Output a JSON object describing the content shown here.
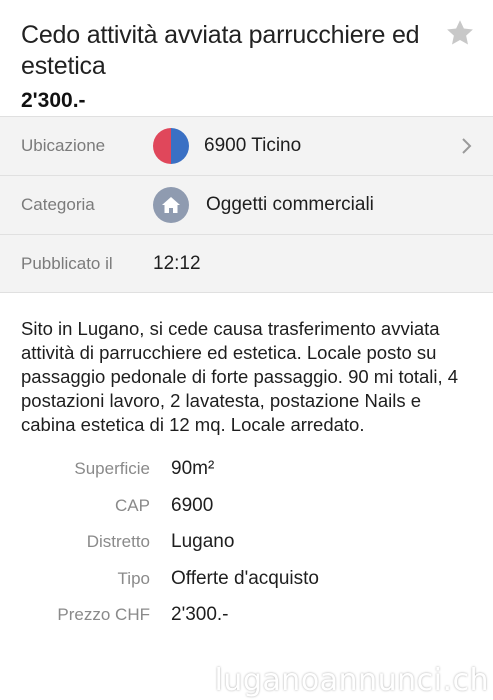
{
  "listing": {
    "title": "Cedo attività avviata parrucchiere ed estetica",
    "price": "2'300.-"
  },
  "info": {
    "location_label": "Ubicazione",
    "location_value": "6900 Ticino",
    "category_label": "Categoria",
    "category_value": "Oggetti commerciali",
    "published_label": "Pubblicato il",
    "published_value": "12:12"
  },
  "description": "Sito in Lugano, si cede causa trasferimento avviata attività di parrucchiere ed estetica. Locale posto su passaggio pedonale di forte passaggio. 90 mi totali, 4 postazioni lavoro, 2 lavatesta, postazione Nails e cabina estetica di 12 mq. Locale arredato.",
  "details": [
    {
      "label": "Superficie",
      "value": "90m²"
    },
    {
      "label": "CAP",
      "value": "6900"
    },
    {
      "label": "Distretto",
      "value": "Lugano"
    },
    {
      "label": "Tipo",
      "value": "Offerte d'acquisto"
    },
    {
      "label": "Prezzo CHF",
      "value": "2'300.-"
    }
  ],
  "watermark": "luganoannunci.ch",
  "icons": {
    "favorite": "star-icon",
    "location": "canton-flag-icon",
    "category": "home-icon",
    "disclosure": "chevron-right-icon"
  },
  "colors": {
    "flag_red": "#e0475b",
    "flag_blue": "#3a70c4",
    "category_icon_bg": "#8f9bb0",
    "row_bg": "#f3f3f3"
  }
}
